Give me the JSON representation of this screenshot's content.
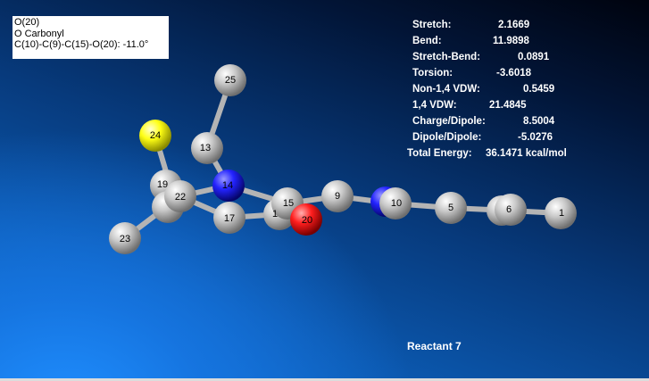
{
  "info_box": {
    "line1": "O(20)",
    "line2": "O Carbonyl",
    "line3": "C(10)-C(9)-C(15)-O(20):  -11.0°"
  },
  "energy": [
    {
      "label": "Stretch:",
      "value": "2.1669"
    },
    {
      "label": "Bend:",
      "value": "11.9898"
    },
    {
      "label": "Stretch-Bend:",
      "value": "0.0891"
    },
    {
      "label": "Torsion:",
      "value": "-3.6018"
    },
    {
      "label": "Non-1,4 VDW:",
      "value": "0.5459"
    },
    {
      "label": "1,4 VDW:",
      "value": "21.4845"
    },
    {
      "label": "Charge/Dipole:",
      "value": "8.5004"
    },
    {
      "label": "Dipole/Dipole:",
      "value": "-5.0276"
    },
    {
      "label": "Total Energy:",
      "value": "36.1471 kcal/mol"
    }
  ],
  "caption": "Reactant 7",
  "colors": {
    "carbon": "#c8c8c8",
    "nitrogen": "#2323ff",
    "oxygen": "#ff1e1e",
    "sulfur": "#ffff14",
    "bond": "#b4b4b4"
  },
  "atom_labels": {
    "a25": "25",
    "a24": "24",
    "a13": "13",
    "a19": "19",
    "a22": "22",
    "a14": "14",
    "a17": "17",
    "a23": "23",
    "a16": "1",
    "a15": "15",
    "a20": "20",
    "a9": "9",
    "a10": "10",
    "a5": "5",
    "a6": "6",
    "a1": "1"
  }
}
